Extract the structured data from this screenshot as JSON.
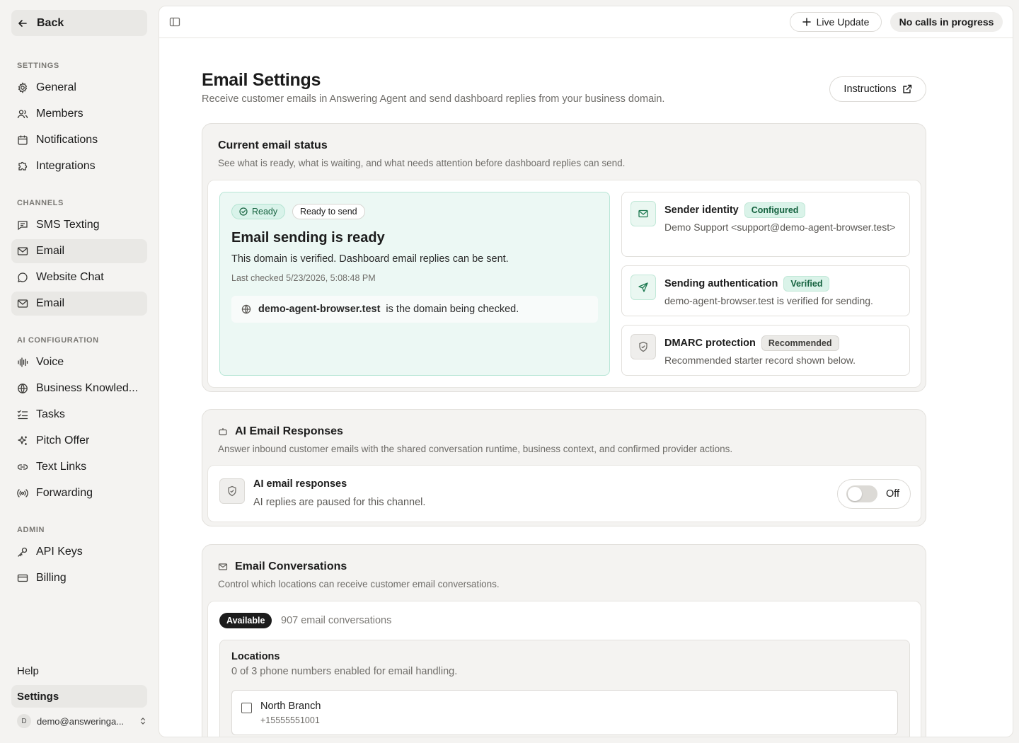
{
  "sidebar": {
    "back_label": "Back",
    "settings_label": "SETTINGS",
    "settings_items": [
      "General",
      "Members",
      "Notifications",
      "Integrations"
    ],
    "channels_label": "CHANNELS",
    "channel_items": [
      "SMS Texting",
      "Email",
      "Website Chat",
      "Email"
    ],
    "ai_label": "AI CONFIGURATION",
    "ai_items": [
      "Voice",
      "Business Knowled...",
      "Tasks",
      "Pitch Offer",
      "Text Links",
      "Forwarding"
    ],
    "admin_label": "ADMIN",
    "admin_items": [
      "API Keys",
      "Billing"
    ],
    "help": "Help",
    "settings": "Settings",
    "avatar_initial": "D",
    "account_email": "demo@answeringa..."
  },
  "topbar": {
    "live_update": "Live Update",
    "calls_status": "No calls in progress"
  },
  "page": {
    "title": "Email Settings",
    "subtitle": "Receive customer emails in Answering Agent and send dashboard replies from your business domain.",
    "instructions": "Instructions"
  },
  "status": {
    "title": "Current email status",
    "subtitle": "See what is ready, what is waiting, and what needs attention before dashboard replies can send.",
    "pill_ready": "Ready",
    "pill_ready_to_send": "Ready to send",
    "ready_title": "Email sending is ready",
    "ready_desc": "This domain is verified. Dashboard email replies can be sent.",
    "last_checked": "Last checked 5/23/2026, 5:08:48 PM",
    "domain": "demo-agent-browser.test",
    "domain_suffix": "is the domain being checked.",
    "sender": {
      "title": "Sender identity",
      "badge": "Configured",
      "desc": "Demo Support <support@demo-agent-browser.test>"
    },
    "auth": {
      "title": "Sending authentication",
      "badge": "Verified",
      "desc": "demo-agent-browser.test is verified for sending."
    },
    "dmarc": {
      "title": "DMARC protection",
      "badge": "Recommended",
      "desc": "Recommended starter record shown below."
    }
  },
  "ai": {
    "title": "AI Email Responses",
    "subtitle": "Answer inbound customer emails with the shared conversation runtime, business context, and confirmed provider actions.",
    "row_title": "AI email responses",
    "row_desc": "AI replies are paused for this channel.",
    "toggle_label": "Off",
    "enabled": false
  },
  "conversations": {
    "title": "Email Conversations",
    "subtitle": "Control which locations can receive customer email conversations.",
    "available": "Available",
    "count": "907 email conversations",
    "locations_title": "Locations",
    "locations_sub": "0 of 3 phone numbers enabled for email handling.",
    "locations": [
      {
        "name": "North Branch",
        "phone": "+15555551001",
        "checked": false
      }
    ]
  }
}
